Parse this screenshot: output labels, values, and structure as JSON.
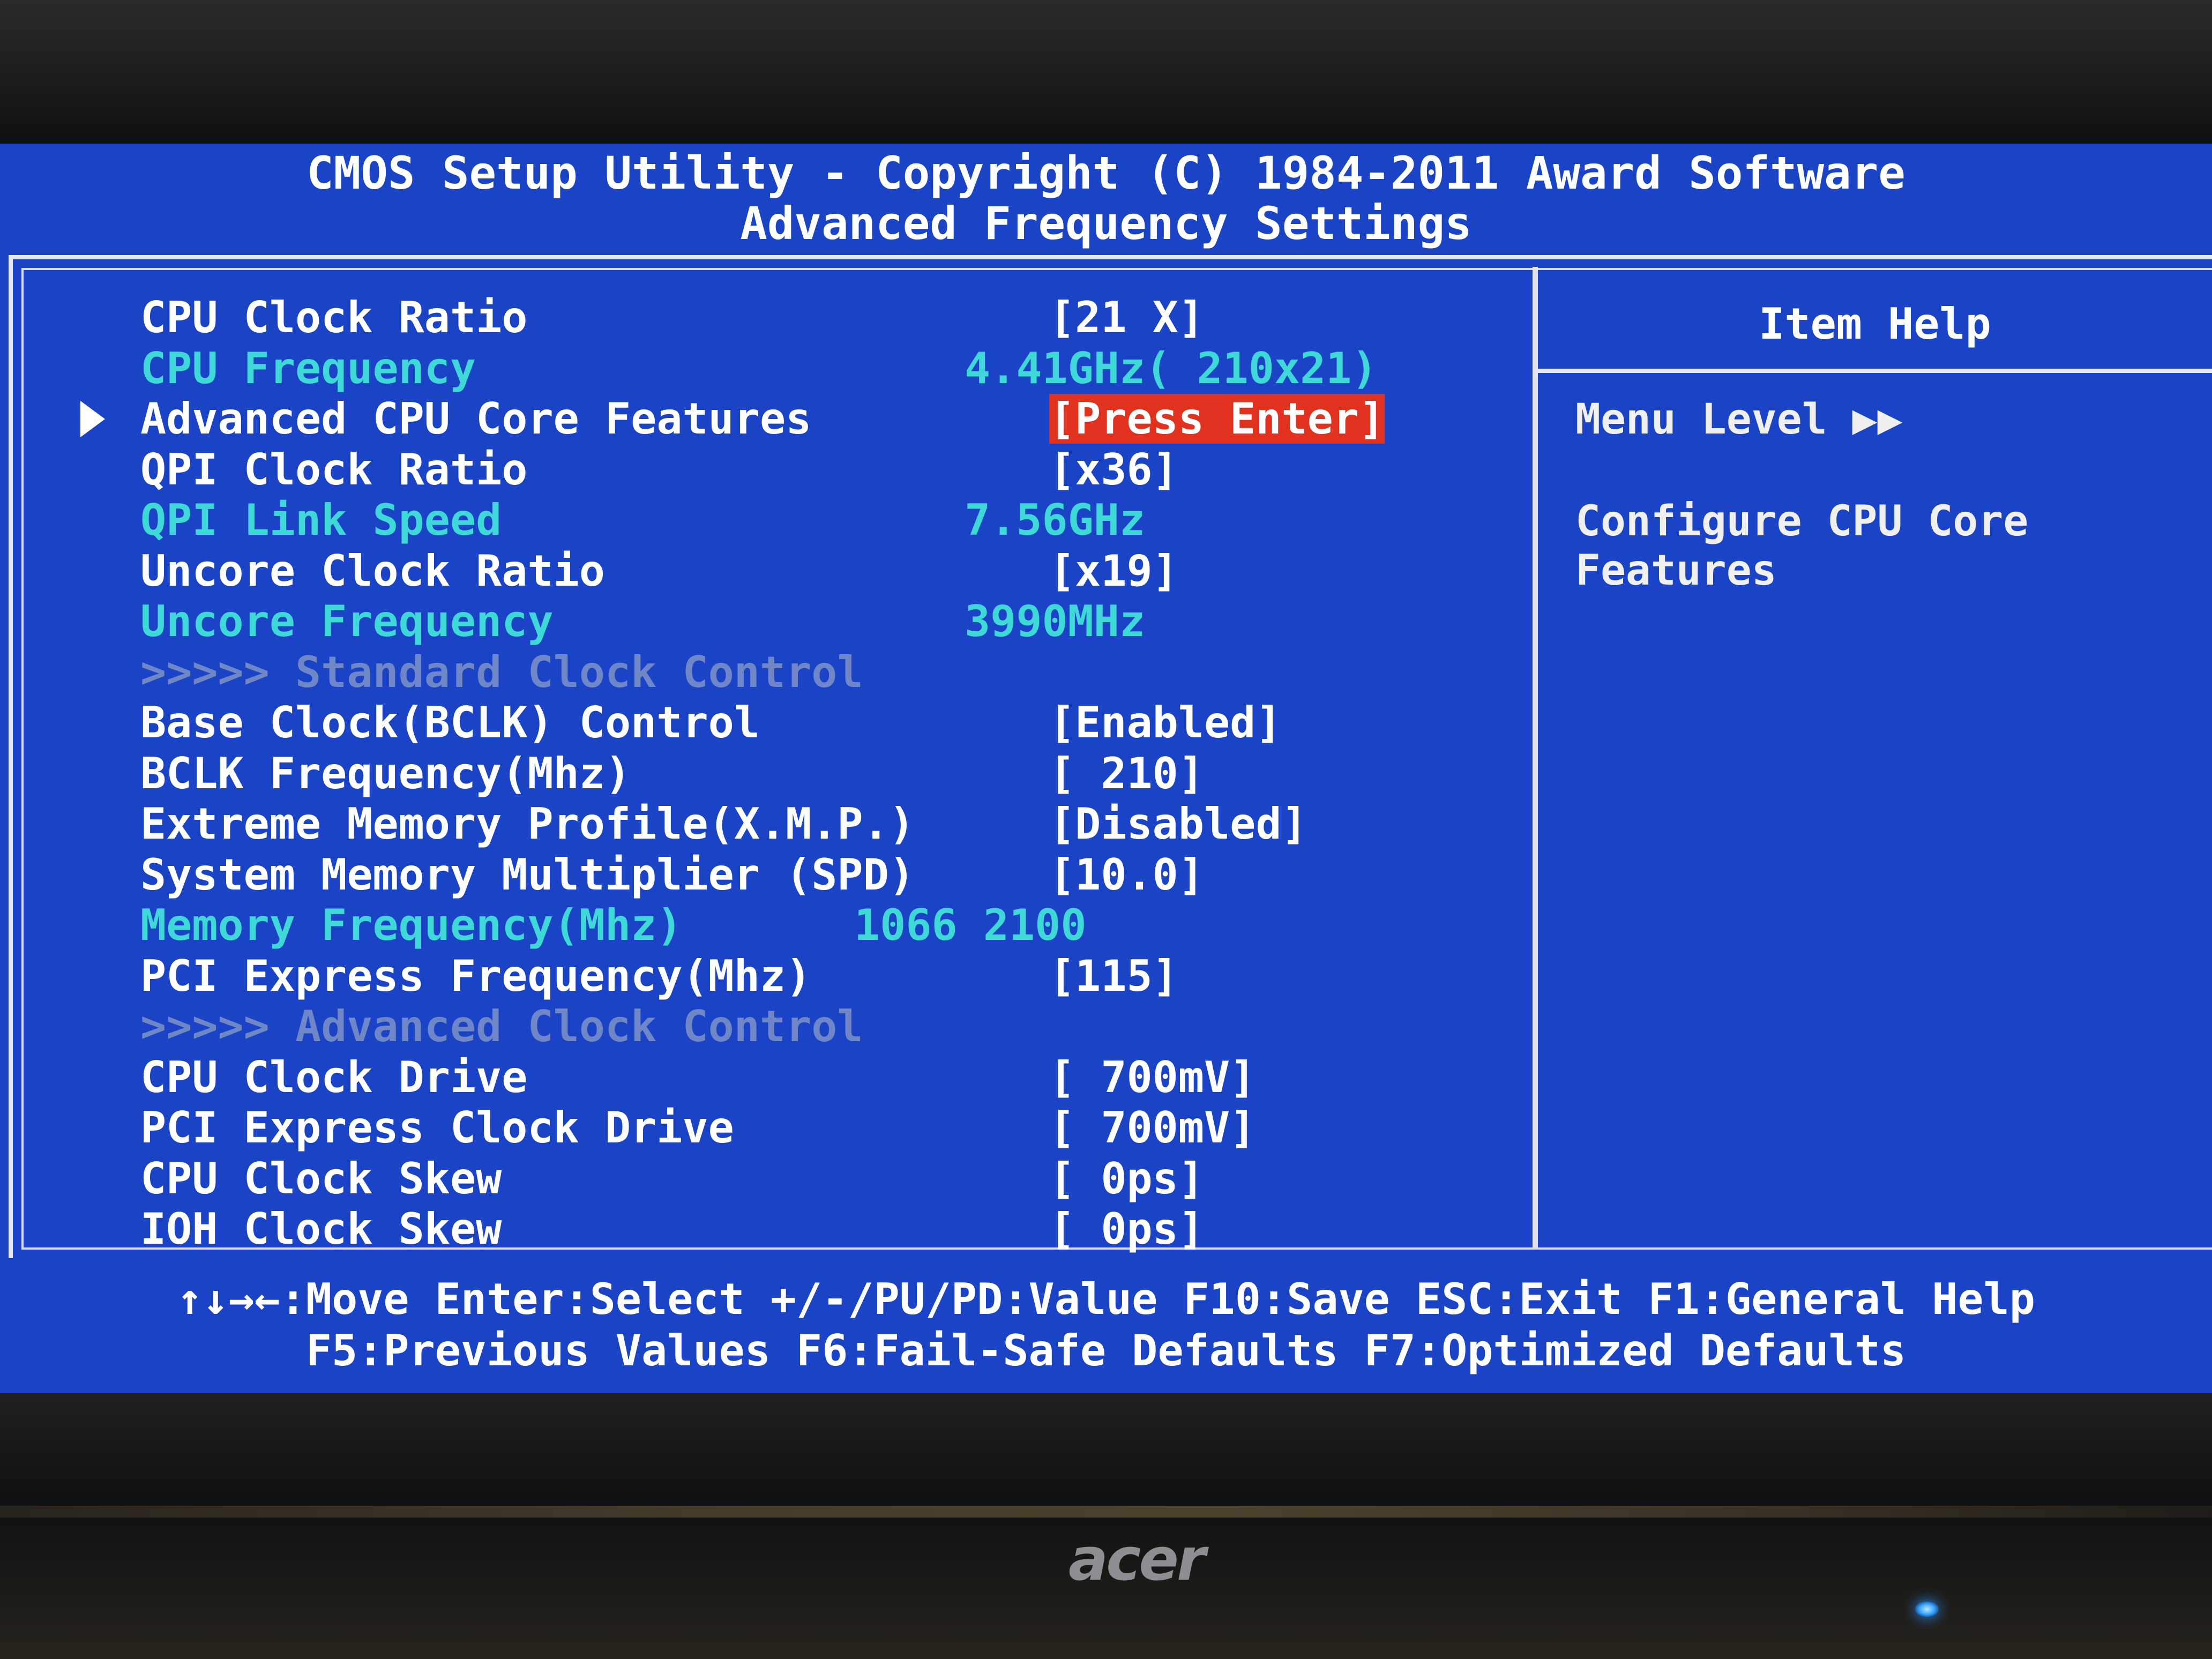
{
  "header": {
    "title": "CMOS Setup Utility - Copyright (C) 1984-2011 Award Software",
    "subtitle": "Advanced Frequency Settings"
  },
  "settings": [
    {
      "label": "CPU Clock Ratio",
      "value": "[21 X]",
      "state": "editable"
    },
    {
      "label": "CPU Frequency",
      "value": "4.41GHz( 210x21)",
      "state": "readonly"
    },
    {
      "label": "Advanced CPU Core Features",
      "value": "[Press Enter]",
      "state": "selected"
    },
    {
      "label": "QPI Clock Ratio",
      "value": "[x36]",
      "state": "editable"
    },
    {
      "label": "QPI Link Speed",
      "value": "7.56GHz",
      "state": "readonly"
    },
    {
      "label": "Uncore Clock Ratio",
      "value": "[x19]",
      "state": "editable"
    },
    {
      "label": "Uncore Frequency",
      "value": "3990MHz",
      "state": "readonly"
    },
    {
      "label": ">>>>> Standard Clock Control",
      "value": "",
      "state": "section"
    },
    {
      "label": "Base Clock(BCLK) Control",
      "value": "[Enabled]",
      "state": "editable"
    },
    {
      "label": "BCLK Frequency(Mhz)",
      "value": "[ 210]",
      "state": "editable"
    },
    {
      "label": "Extreme Memory Profile(X.M.P.)",
      "value": "[Disabled]",
      "state": "editable"
    },
    {
      "label": "System Memory Multiplier (SPD)",
      "value": "[10.0]",
      "state": "editable"
    },
    {
      "label": "Memory Frequency(Mhz)",
      "value": "1066     2100",
      "state": "readonly"
    },
    {
      "label": "PCI Express Frequency(Mhz)",
      "value": "[115]",
      "state": "editable"
    },
    {
      "label": ">>>>> Advanced Clock Control",
      "value": "",
      "state": "section"
    },
    {
      "label": "CPU Clock Drive",
      "value": "[ 700mV]",
      "state": "editable"
    },
    {
      "label": "PCI Express Clock Drive",
      "value": "[ 700mV]",
      "state": "editable"
    },
    {
      "label": "CPU Clock Skew",
      "value": "[   0ps]",
      "state": "editable"
    },
    {
      "label": "IOH Clock Skew",
      "value": "[   0ps]",
      "state": "editable"
    }
  ],
  "help": {
    "title": "Item Help",
    "menu_level": "Menu Level   ▶▶",
    "line1": "Configure CPU Core",
    "line2": "Features"
  },
  "footer": {
    "line1": "↑↓→←:Move  Enter:Select  +/-/PU/PD:Value  F10:Save  ESC:Exit  F1:General Help",
    "line2": "F5:Previous Values  F6:Fail-Safe Defaults  F7:Optimized Defaults"
  },
  "brand": "acer",
  "colors": {
    "screen_bg": "#1a43c6",
    "editable": "#ffffff",
    "readonly": "#3fd8d8",
    "section": "#6f86c8",
    "highlight": "#e0321e"
  }
}
